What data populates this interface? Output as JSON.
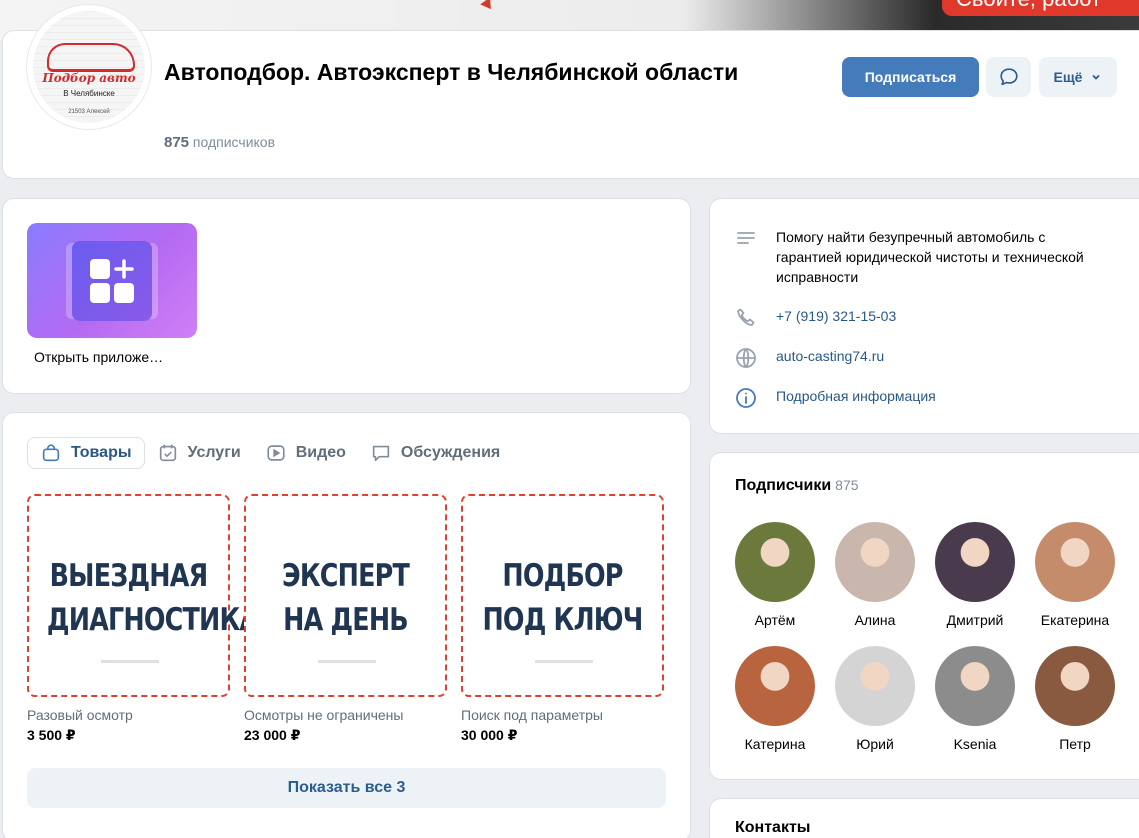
{
  "cover": {
    "badge_text": "Свойте, работ"
  },
  "header": {
    "avatar": {
      "title": "Подбор авто",
      "subtitle": "В Челябинске",
      "tiny": "21503 Алексей"
    },
    "group_name": "Автоподбор. Автоэксперт в Челябинской области",
    "subscribers_count": "875",
    "subscribers_label": "подписчиков",
    "subscribe_label": "Подписаться",
    "more_label": "Ещё"
  },
  "apps": {
    "app_label": "Открыть приложе…"
  },
  "goods": {
    "tabs": [
      {
        "label": "Товары",
        "icon": "bag-icon"
      },
      {
        "label": "Услуги",
        "icon": "services-icon"
      },
      {
        "label": "Видео",
        "icon": "video-icon"
      },
      {
        "label": "Обсуждения",
        "icon": "discussion-icon"
      }
    ],
    "products": [
      {
        "line1": "ВЫЕЗДНАЯ",
        "line2": "ДИАГНОСТИКА",
        "name": "Разовый осмотр",
        "price": "3 500 ₽"
      },
      {
        "line1": "ЭКСПЕРТ",
        "line2": "НА ДЕНЬ",
        "name": "Осмотры не ограничены",
        "price": "23 000 ₽"
      },
      {
        "line1": "ПОДБОР",
        "line2": "ПОД КЛЮЧ",
        "name": "Поиск под параметры",
        "price": "30 000 ₽"
      }
    ],
    "show_all_label": "Показать все 3"
  },
  "info": {
    "description": "Помогу найти безупречный автомобиль с гарантией юридической чистоты и технической исправности",
    "phone": "+7 (919) 321-15-03",
    "website": "auto-casting74.ru",
    "details_link": "Подробная информация"
  },
  "followers": {
    "title": "Подписчики",
    "count": "875",
    "people": [
      {
        "name": "Артём",
        "color": "#6b7a3c"
      },
      {
        "name": "Алина",
        "color": "#c9b7ad"
      },
      {
        "name": "Дмитрий",
        "color": "#4a3a4e"
      },
      {
        "name": "Екатерина",
        "color": "#c58c6c"
      },
      {
        "name": "Катерина",
        "color": "#b8653f"
      },
      {
        "name": "Юрий",
        "color": "#d4d4d4"
      },
      {
        "name": "Ksenia",
        "color": "#8c8c8c"
      },
      {
        "name": "Петр",
        "color": "#8a5a40"
      }
    ]
  },
  "next_card": {
    "title": "Контакты"
  },
  "colors": {
    "accent": "#447bba",
    "link": "#2a5885",
    "product_border": "#e0402f",
    "background": "#ebedf0"
  }
}
